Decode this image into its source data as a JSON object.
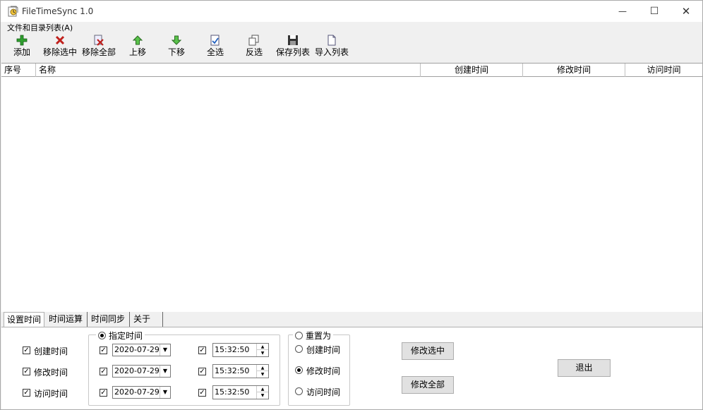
{
  "window": {
    "title": "FileTimeSync 1.0",
    "min_glyph": "—",
    "max_glyph": "☐",
    "close_glyph": "✕"
  },
  "menu": {
    "label": "文件和目录列表(A)"
  },
  "toolbar": [
    {
      "id": "add",
      "label": "添加",
      "icon": "plus-icon"
    },
    {
      "id": "remove_selected",
      "label": "移除选中",
      "icon": "x-icon"
    },
    {
      "id": "remove_all",
      "label": "移除全部",
      "icon": "remove-all-icon"
    },
    {
      "id": "move_up",
      "label": "上移",
      "icon": "arrow-up-icon"
    },
    {
      "id": "move_down",
      "label": "下移",
      "icon": "arrow-down-icon"
    },
    {
      "id": "select_all",
      "label": "全选",
      "icon": "select-all-icon"
    },
    {
      "id": "invert",
      "label": "反选",
      "icon": "invert-icon"
    },
    {
      "id": "save_list",
      "label": "保存列表",
      "icon": "save-icon"
    },
    {
      "id": "import_list",
      "label": "导入列表",
      "icon": "import-icon"
    }
  ],
  "list": {
    "columns": [
      "序号",
      "名称",
      "创建时间",
      "修改时间",
      "访问时间"
    ],
    "rows": []
  },
  "tabs": [
    "设置时间",
    "时间运算",
    "时间同步",
    "关于"
  ],
  "set_time": {
    "checks": [
      {
        "label": "创建时间",
        "checked": true
      },
      {
        "label": "修改时间",
        "checked": true
      },
      {
        "label": "访问时间",
        "checked": true
      }
    ],
    "specify_group": {
      "legend": "指定时间",
      "rows": [
        {
          "date": "2020-07-29",
          "time": "15:32:50"
        },
        {
          "date": "2020-07-29",
          "time": "15:32:50"
        },
        {
          "date": "2020-07-29",
          "time": "15:32:50"
        }
      ]
    },
    "reset_group": {
      "legend": "重置为",
      "options": [
        "创建时间",
        "修改时间",
        "访问时间"
      ],
      "selected": "修改时间"
    },
    "buttons": {
      "modify_selected": "修改选中",
      "modify_all": "修改全部",
      "exit": "退出"
    }
  },
  "colors": {
    "accent": "#2a7a2a",
    "remove": "#c0201c"
  }
}
